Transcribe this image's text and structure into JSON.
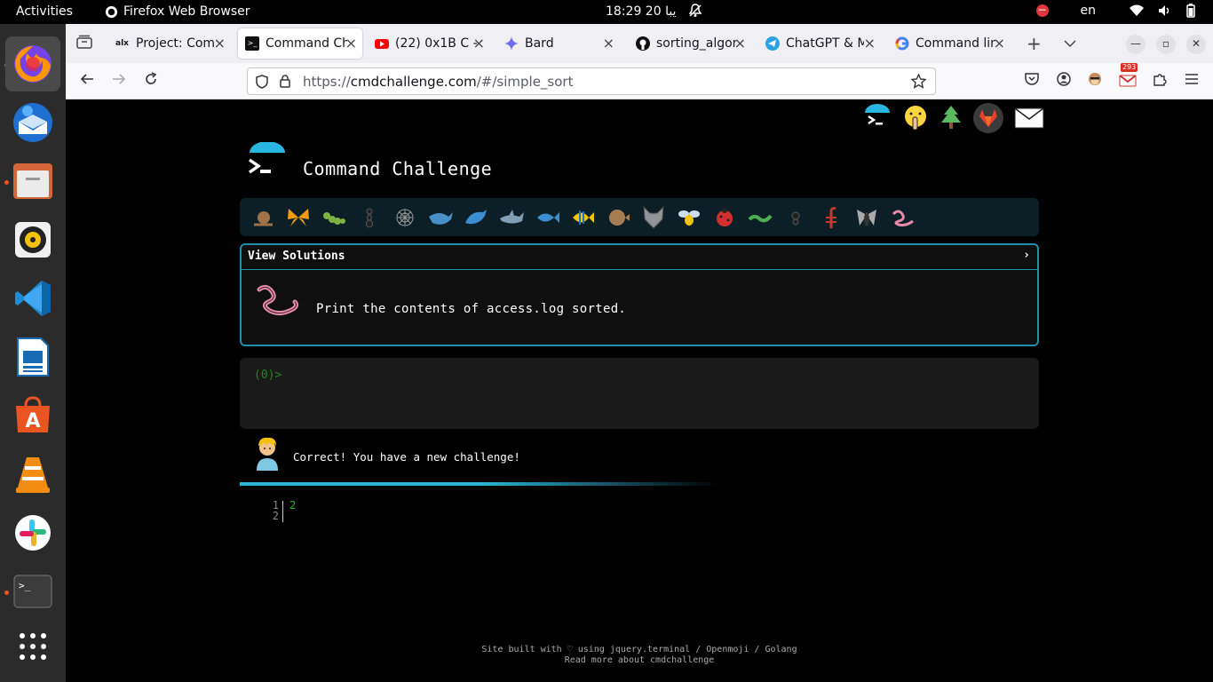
{
  "system": {
    "activities": "Activities",
    "app_name": "Firefox Web Browser",
    "clock": "18:29  20 يبا",
    "lang": "en"
  },
  "dock": {
    "items": [
      "firefox-icon",
      "thunderbird-icon",
      "files-icon",
      "rhythmbox-icon",
      "vscode-icon",
      "writer-icon",
      "app-center-icon",
      "vlc-icon",
      "slack-icon",
      "terminal-icon",
      "app-grid-icon"
    ]
  },
  "tabs": [
    {
      "title": "Project: Comm",
      "favicon": "alx-icon"
    },
    {
      "title": "Command Ch",
      "favicon": "terminal-favicon"
    },
    {
      "title": "(22) 0x1B C -",
      "favicon": "youtube-icon"
    },
    {
      "title": "Bard",
      "favicon": "bard-icon"
    },
    {
      "title": "sorting_algor",
      "favicon": "github-icon"
    },
    {
      "title": "ChatGPT & M",
      "favicon": "telegram-icon"
    },
    {
      "title": "Command lin",
      "favicon": "google-icon"
    }
  ],
  "navbar": {
    "url_prefix": "https://",
    "url_host": "cmdchallenge.com",
    "url_path": "/#/simple_sort",
    "gmail_badge": "293"
  },
  "page": {
    "title": "Command Challenge",
    "view_solutions": "View Solutions",
    "chevron": "›",
    "challenge_text": "Print the contents of access.log sorted.",
    "prompt_open": "(",
    "prompt_num": "0",
    "prompt_close": ")>",
    "feedback": "Correct! You have a new challenge!",
    "editor": {
      "line1": "1",
      "line2": "2",
      "code": "2"
    },
    "footer_line1": "Site built with ♡ using jquery.terminal / Openmoji / Golang",
    "footer_line2": "Read more about cmdchallenge"
  },
  "colors": {
    "accent": "#1f8ea8",
    "prompt_green": "#13c113",
    "level_bar": "#0d1f26"
  }
}
